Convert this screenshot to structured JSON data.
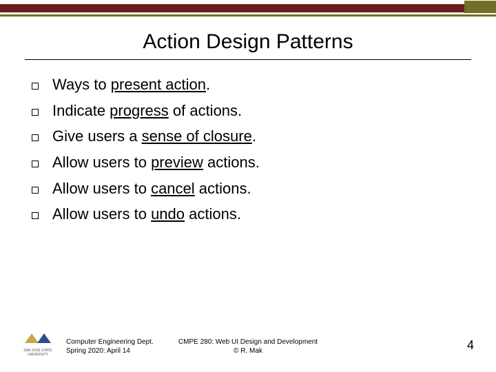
{
  "title": "Action Design Patterns",
  "bullets": [
    {
      "pre": "Ways to ",
      "underlined": "present action",
      "post": "."
    },
    {
      "pre": "Indicate ",
      "underlined": "progress",
      "post": " of actions."
    },
    {
      "pre": "Give users a ",
      "underlined": "sense of closure",
      "post": "."
    },
    {
      "pre": "Allow users to ",
      "underlined": "preview",
      "post": " actions."
    },
    {
      "pre": "Allow users to ",
      "underlined": "cancel",
      "post": " actions."
    },
    {
      "pre": "Allow users to ",
      "underlined": "undo",
      "post": " actions."
    }
  ],
  "footer": {
    "left_line1": "Computer Engineering Dept.",
    "left_line2": "Spring 2020: April 14",
    "center_line1": "CMPE 280: Web UI Design and Development",
    "center_line2": "© R. Mak",
    "page_number": "4",
    "logo_text": "SAN JOSE STATE\nUNIVERSITY"
  }
}
